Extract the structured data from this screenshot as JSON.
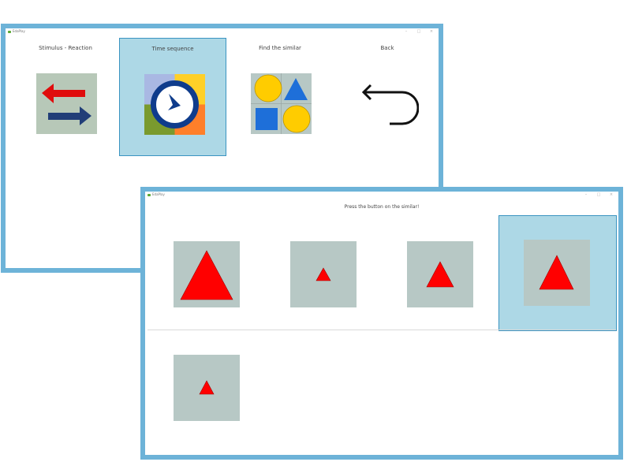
{
  "colors": {
    "window_border": "#6db3d8",
    "selection_fill": "#add8e6",
    "selection_border": "#3a94c1",
    "tile_background": "#b7c8c5",
    "triangle_fill": "#ff0000"
  },
  "back_window": {
    "title": "EdaPlay",
    "controls": [
      "–",
      "□",
      "×"
    ],
    "menu": [
      {
        "label": "Stimulus - Reaction",
        "icon": "arrows-icon"
      },
      {
        "label": "Time sequence",
        "icon": "clock-icon",
        "selected": true
      },
      {
        "label": "Find the similar",
        "icon": "shapes-icon"
      },
      {
        "label": "Back",
        "icon": "back-arrow-icon"
      }
    ]
  },
  "front_window": {
    "title": "EdaPlay",
    "controls": [
      "–",
      "□",
      "×"
    ],
    "prompt": "Press the button on the similar!",
    "options": [
      {
        "shape": "triangle",
        "size": "large"
      },
      {
        "shape": "triangle",
        "size": "small"
      },
      {
        "shape": "triangle",
        "size": "medium"
      },
      {
        "shape": "triangle",
        "size": "medium-large",
        "selected": true
      }
    ],
    "target": {
      "shape": "triangle",
      "size": "small"
    }
  }
}
